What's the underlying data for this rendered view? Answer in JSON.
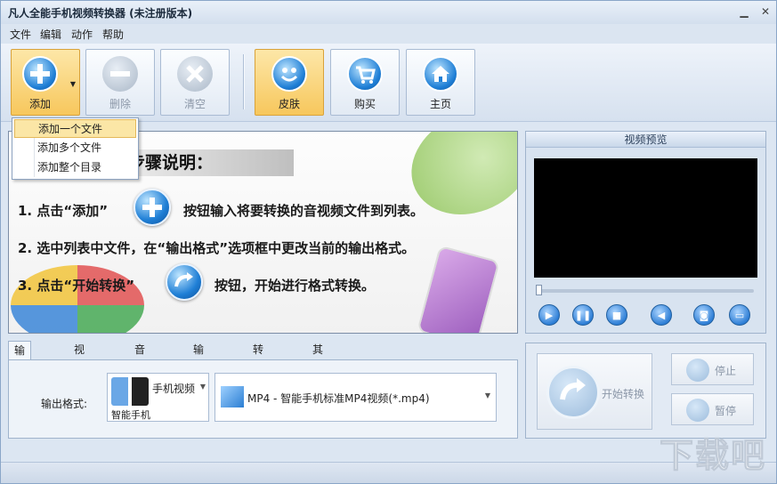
{
  "window": {
    "title": "凡人全能手机视频转换器 (未注册版本)"
  },
  "menu": [
    "文件",
    "编辑",
    "动作",
    "帮助"
  ],
  "toolbar": {
    "add": "添加",
    "delete": "删除",
    "clear": "清空",
    "skin": "皮肤",
    "buy": "购买",
    "home": "主页"
  },
  "add_menu": [
    "添加一个文件",
    "添加多个文件",
    "添加整个目录"
  ],
  "instructions": {
    "heading": "步骤说明：",
    "step1_a": "1. 点击“添加”",
    "step1_b": "按钮输入将要转换的音视频文件到列表。",
    "step2": "2. 选中列表中文件，在“输出格式”选项框中更改当前的输出格式。",
    "step3_a": "3. 点击“开始转换”",
    "step3_b": "按钮，开始进行格式转换。"
  },
  "preview": {
    "title": "视频预览"
  },
  "tabs": [
    "输出格式",
    "视频参数",
    "音频参数",
    "输出目录",
    "转换设置",
    "其他设置"
  ],
  "output": {
    "label": "输出格式:",
    "device": "手机视频",
    "device_sub": "智能手机",
    "format": "MP4 - 智能手机标准MP4视频(*.mp4)"
  },
  "convert": {
    "start": "开始转换",
    "stop": "停止",
    "pause": "暂停"
  },
  "watermark": "下载吧",
  "colors": {
    "accent": "#f7c75c",
    "panel": "#dce6f2",
    "button_blue": "#2f7fd6"
  }
}
